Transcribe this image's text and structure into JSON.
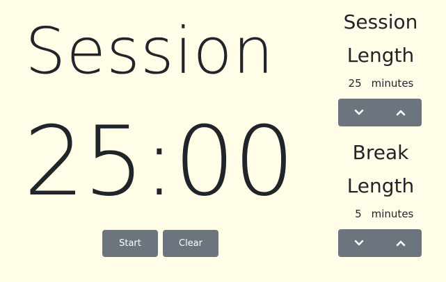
{
  "timer": {
    "mode_label": "Session",
    "display_time": "25:00"
  },
  "controls": {
    "start_label": "Start",
    "clear_label": "Clear"
  },
  "settings": {
    "session": {
      "title_line1": "Session",
      "title_line2": "Length",
      "value": "25",
      "unit": "minutes"
    },
    "break": {
      "title_line1": "Break",
      "title_line2": "Length",
      "value": "5",
      "unit": "minutes"
    }
  },
  "theme": {
    "background": "#fffde7",
    "button": "#6c757d",
    "text": "#212529"
  },
  "icons": {
    "decrement": "chevron-down-icon",
    "increment": "chevron-up-icon"
  }
}
